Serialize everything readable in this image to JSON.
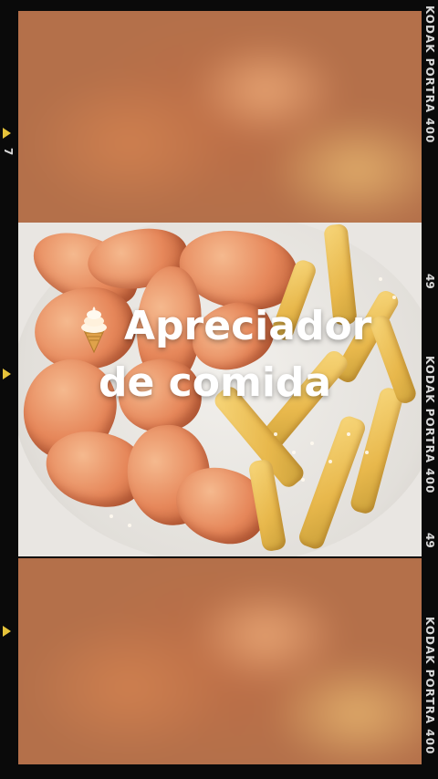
{
  "overlay": {
    "line1": "Apreciador",
    "line2": "de comida",
    "emoji_icon": "soft-ice-cream-icon"
  },
  "film_strip": {
    "right_labels": [
      "KODAK PORTRA 400",
      "KODAK PORTRA 400",
      "KODAK PORTRA 400"
    ],
    "right_numbers": [
      "49",
      "49"
    ],
    "left_number": "7"
  },
  "colors": {
    "film_black": "#0a0a0a",
    "text_white": "#ffffff",
    "marker_yellow": "#e6c33a",
    "shrimp": "#e6875a",
    "fries": "#e8b84c"
  }
}
